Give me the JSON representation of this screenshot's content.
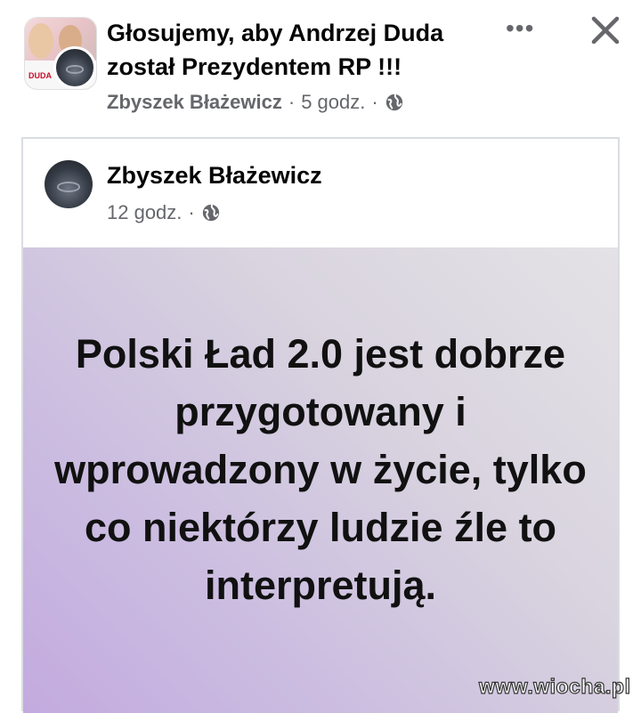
{
  "group": {
    "title": "Głosujemy, aby Andrzej Duda został Prezydentem RP !!!",
    "avatar_tag": "DUDA",
    "author": "Zbyszek Błażewicz",
    "separator": "·",
    "time": "5 godz.",
    "privacy_icon": "globe-icon"
  },
  "header_actions": {
    "more_icon": "more-horizontal-icon",
    "more_glyph": "•••",
    "close_icon": "close-icon"
  },
  "shared_post": {
    "author": "Zbyszek Błażewicz",
    "separator": "·",
    "time": "12 godz.",
    "privacy_icon": "globe-icon",
    "text": "Polski Ład 2.0 jest dobrze przygotowany i wprowadzony w życie, tylko co niektórzy ludzie źle to interpretują.",
    "background_gradient": [
      "#e4e2e6",
      "#c3aadf"
    ]
  },
  "watermark": "www.wiocha.pl",
  "colors": {
    "primary_text": "#050505",
    "secondary_text": "#65676b",
    "card_border": "#dadde1"
  }
}
